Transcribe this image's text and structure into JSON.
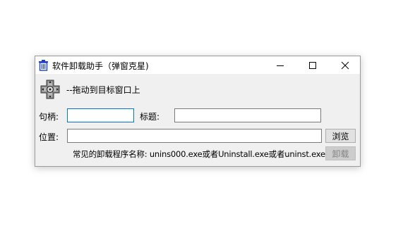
{
  "window": {
    "title": "软件卸载助手（弹窗克星)",
    "icon": "trash-bin-icon",
    "controls": {
      "minimize": "minimize-icon",
      "maximize": "maximize-icon",
      "close": "close-icon"
    }
  },
  "finder": {
    "icon": "drag-crosshair-icon",
    "hint": "--拖动到目标窗口上"
  },
  "form": {
    "handle_label": "句柄:",
    "handle_value": "",
    "title_label": "标题:",
    "title_value": "",
    "position_label": "位置:",
    "position_value": "",
    "browse_label": "浏览",
    "note": "常见的卸载程序名称: unins000.exe或者Uninstall.exe或者uninst.exe",
    "uninstall_label": "卸载",
    "uninstall_enabled": false
  },
  "colors": {
    "focus_border": "#0078d7",
    "icon_blue": "#1c3fd6",
    "disabled_text": "#838383"
  }
}
